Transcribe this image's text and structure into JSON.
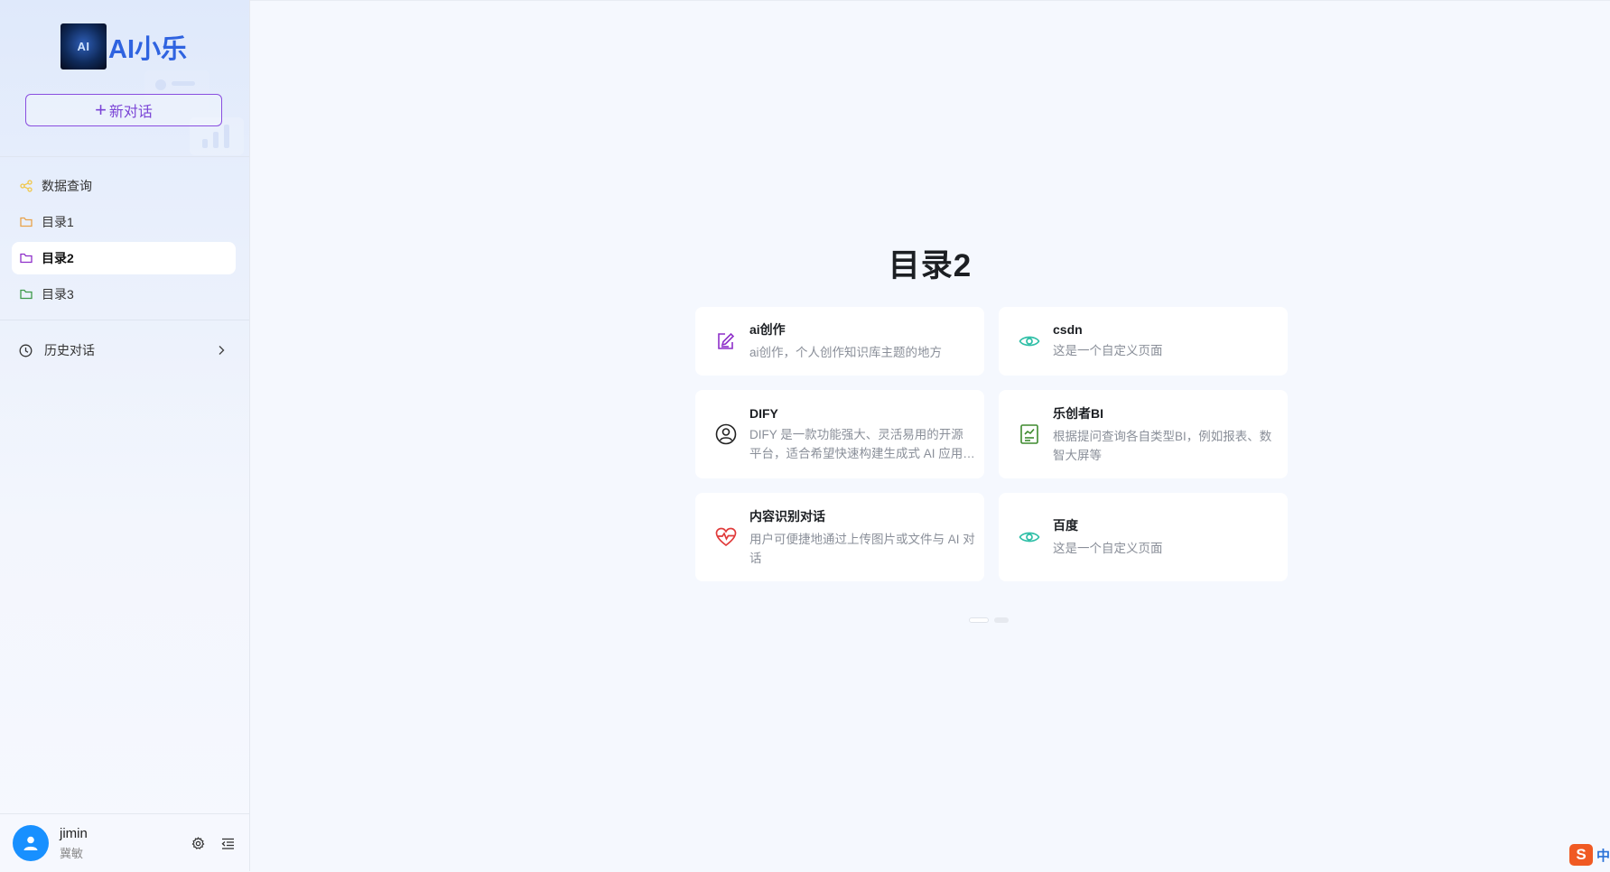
{
  "sidebar": {
    "brand": {
      "logo_text": "AI",
      "name": "AI小乐"
    },
    "new_chat_label": "新对话",
    "items": [
      {
        "label": "数据查询",
        "icon": "share-nodes-icon",
        "color": "#f0c74a"
      },
      {
        "label": "目录1",
        "icon": "folder-icon",
        "color": "#e8a24a"
      },
      {
        "label": "目录2",
        "icon": "folder-icon",
        "color": "#8e2fc9",
        "active": true
      },
      {
        "label": "目录3",
        "icon": "folder-icon",
        "color": "#3e9a4a"
      }
    ],
    "history_label": "历史对话",
    "user": {
      "name": "jimin",
      "sub": "冀敏"
    }
  },
  "main": {
    "title": "目录2",
    "cards": [
      {
        "title": "ai创作",
        "desc": "ai创作，个人创作知识库主题的地方",
        "icon": "edit-note-icon",
        "color": "#8e2fc9"
      },
      {
        "title": "csdn",
        "desc": "这是一个自定义页面",
        "icon": "eye-icon",
        "color": "#2fbfa7"
      },
      {
        "title": "DIFY",
        "desc": "DIFY 是一款功能强大、灵活易用的开源平台，适合希望快速构建生成式 AI 应用的开发者。",
        "icon": "user-circle-icon",
        "color": "#222222"
      },
      {
        "title": "乐创者BI",
        "desc": "根据提问查询各自类型BI，例如报表、数智大屏等",
        "icon": "report-chart-icon",
        "color": "#3e8a2e"
      },
      {
        "title": "内容识别对话",
        "desc": "用户可便捷地通过上传图片或文件与 AI 对话",
        "icon": "heart-pulse-icon",
        "color": "#e03a3a"
      },
      {
        "title": "百度",
        "desc": "这是一个自定义页面",
        "icon": "eye-icon",
        "color": "#2fbfa7"
      }
    ],
    "pager": {
      "current": 1,
      "total": 2
    }
  },
  "ime": {
    "logo": "S",
    "mode": "中"
  }
}
